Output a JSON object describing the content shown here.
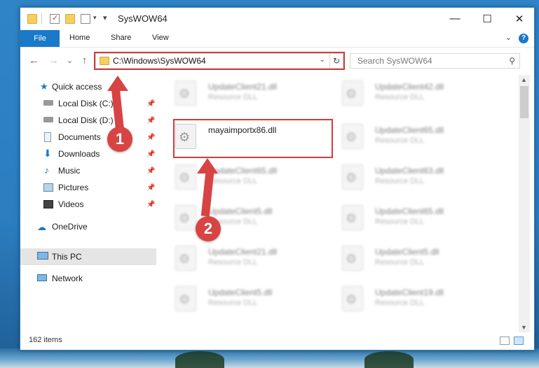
{
  "window": {
    "title": "SysWOW64",
    "controls": {
      "minimize": "—",
      "maximize": "☐",
      "close": "✕"
    }
  },
  "ribbon": {
    "tabs": [
      {
        "label": "File"
      },
      {
        "label": "Home"
      },
      {
        "label": "Share"
      },
      {
        "label": "View"
      }
    ],
    "help": "?"
  },
  "nav": {
    "address": "C:\\Windows\\SysWOW64",
    "search_placeholder": "Search SysWOW64",
    "back_icon": "←",
    "forward_icon": "→",
    "recent_icon": "⌄",
    "up_icon": "↑",
    "refresh_icon": "↻"
  },
  "sidebar": {
    "items": [
      {
        "label": "Quick access",
        "icon": "star-icon",
        "pinned": false
      },
      {
        "label": "Local Disk (C:)",
        "icon": "drive-icon",
        "pinned": true
      },
      {
        "label": "Local Disk (D:)",
        "icon": "drive-icon",
        "pinned": true
      },
      {
        "label": "Documents",
        "icon": "documents-icon",
        "pinned": true
      },
      {
        "label": "Downloads",
        "icon": "download-icon",
        "pinned": true
      },
      {
        "label": "Music",
        "icon": "music-icon",
        "pinned": true
      },
      {
        "label": "Pictures",
        "icon": "pictures-icon",
        "pinned": true
      },
      {
        "label": "Videos",
        "icon": "videos-icon",
        "pinned": true
      },
      {
        "label": "OneDrive",
        "icon": "cloud-icon",
        "pinned": false
      },
      {
        "label": "This PC",
        "icon": "computer-icon",
        "pinned": false,
        "selected": true
      },
      {
        "label": "Network",
        "icon": "network-icon",
        "pinned": false
      }
    ]
  },
  "files": {
    "highlighted": {
      "name": "mayaimportx86.dll",
      "type": ""
    },
    "left_column": [
      {
        "name": "UpdateClient21.dll",
        "type": "Resource DLL"
      },
      {
        "name": "UpdateClient65.dll",
        "type": "Resource DLL"
      },
      {
        "name": "UpdateClient5.dll",
        "type": "Resource DLL"
      },
      {
        "name": "UpdateClient21.dll",
        "type": "Resource DLL"
      },
      {
        "name": "UpdateClient5.dll",
        "type": "Resource DLL"
      }
    ],
    "right_column": [
      {
        "name": "UpdateClient42.dll",
        "type": "Resource DLL"
      },
      {
        "name": "UpdateClient65.dll",
        "type": "Resource DLL"
      },
      {
        "name": "UpdateClient63.dll",
        "type": "Resource DLL"
      },
      {
        "name": "UpdateClient65.dll",
        "type": "Resource DLL"
      },
      {
        "name": "UpdateClient5.dll",
        "type": "Resource DLL"
      },
      {
        "name": "UpdateClient19.dll",
        "type": "Resource DLL"
      }
    ]
  },
  "status": {
    "item_count": "162 items"
  },
  "callouts": {
    "step1": "1",
    "step2": "2"
  },
  "colors": {
    "accent": "#1979ca",
    "callout": "#d84343",
    "highlight_box": "#d23b3b"
  }
}
